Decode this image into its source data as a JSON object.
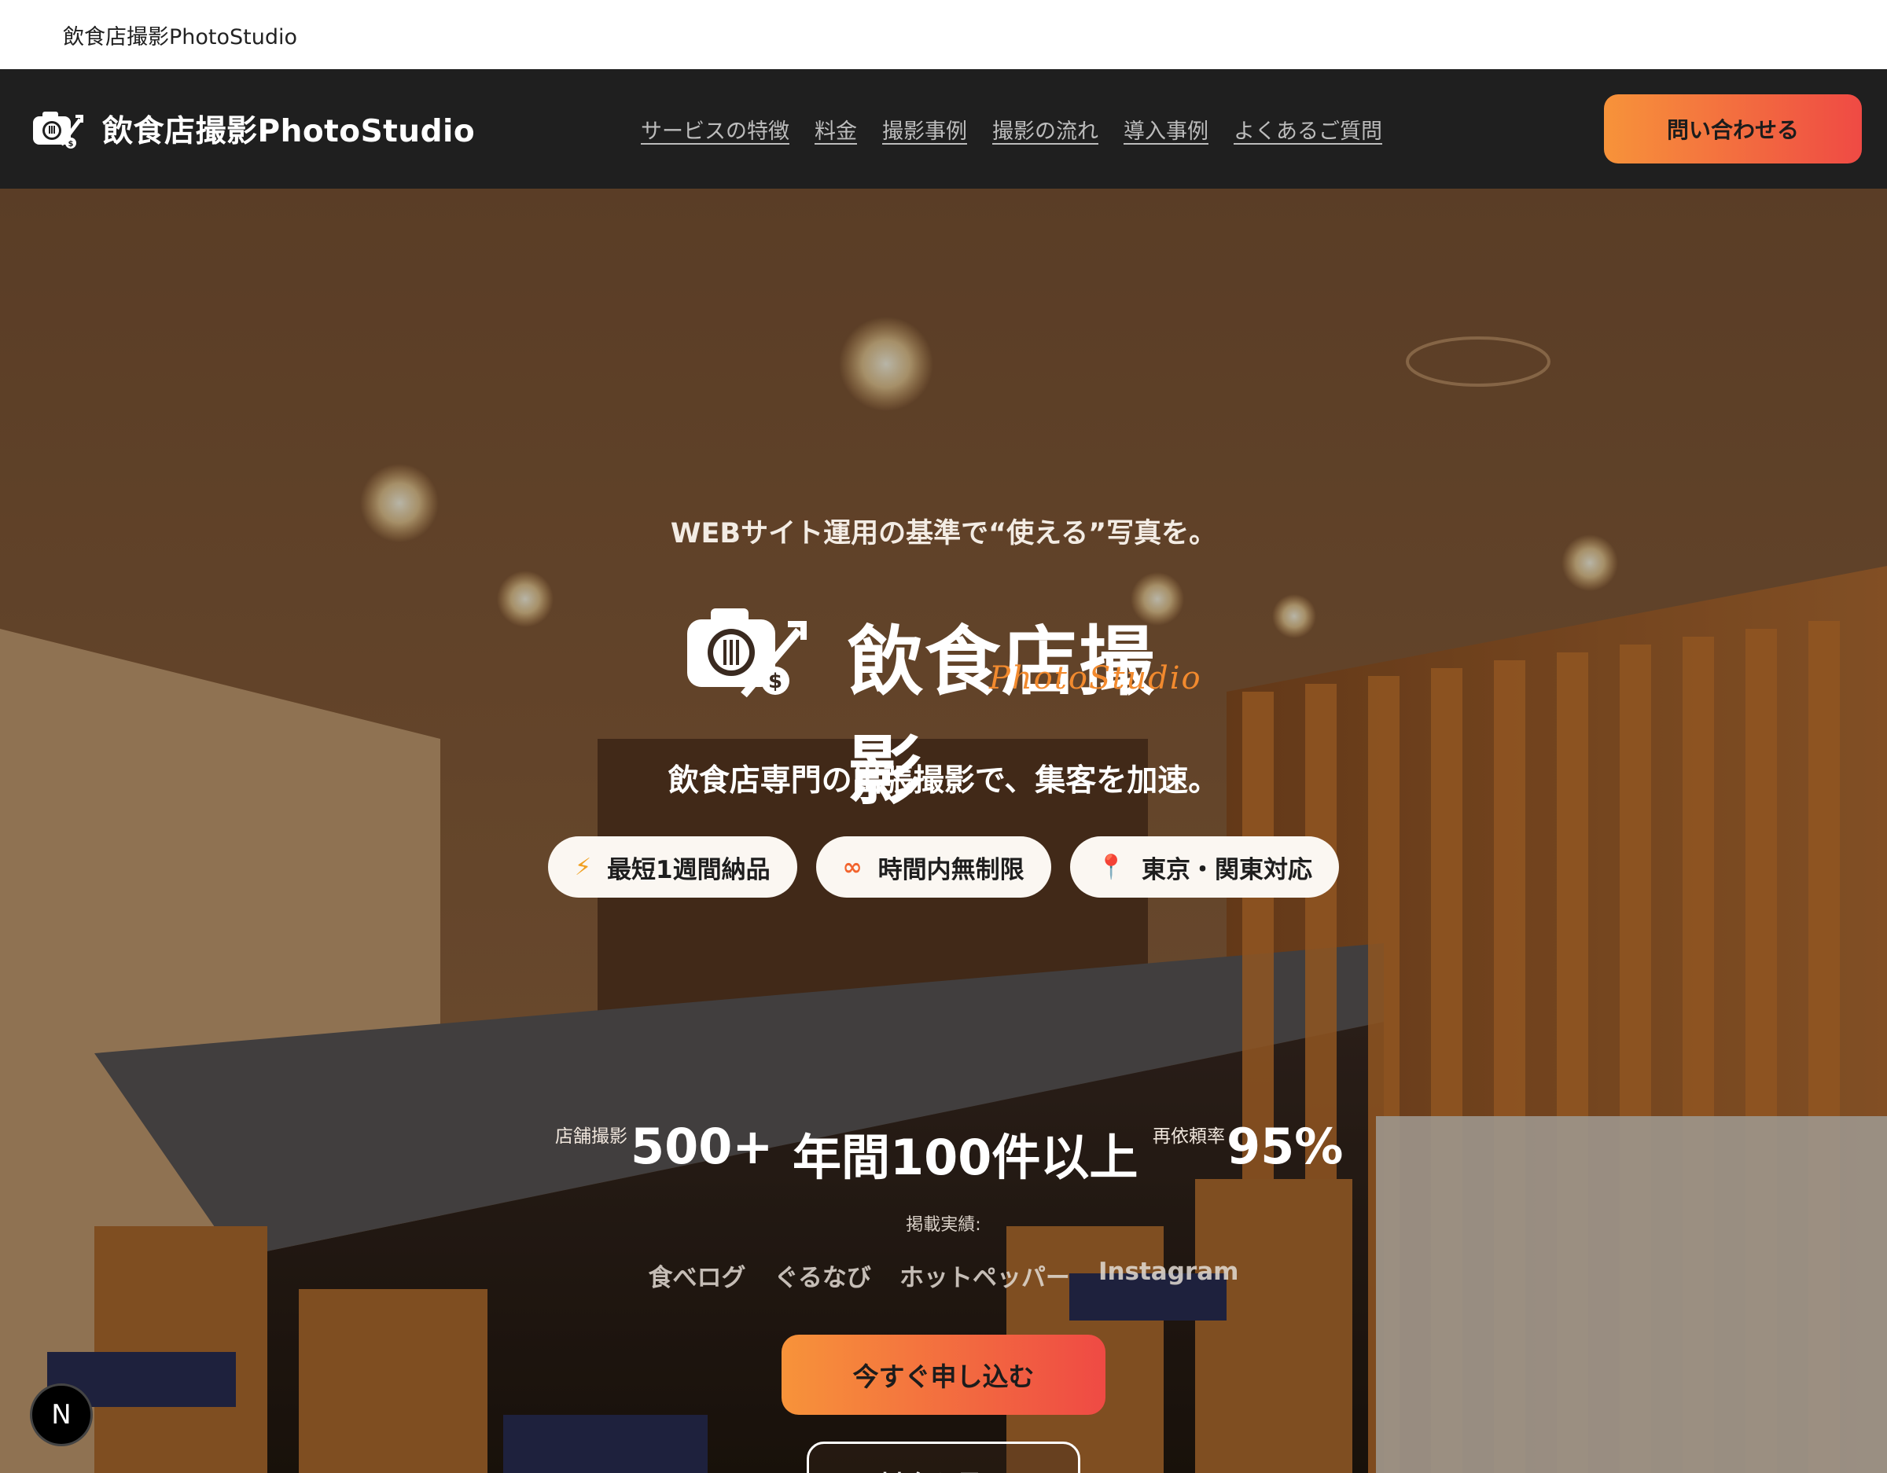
{
  "browser": {
    "tab_title": "飲食店撮影PhotoStudio"
  },
  "nav": {
    "brand_name": "飲食店撮影PhotoStudio",
    "brand_icon": "camera-fork-icon",
    "links": [
      "サービスの特徴",
      "料金",
      "撮影事例",
      "撮影の流れ",
      "導入事例",
      "よくあるご質問"
    ],
    "cta_label": "問い合わせる"
  },
  "hero": {
    "tagline": "WEBサイト運用の基準で“使える”写真を。",
    "logo_jp": "飲食店撮影",
    "logo_en": "PhotoStudio",
    "subtitle": "飲食店専門の出張撮影で、集客を加速。",
    "badges": [
      {
        "icon": "lightning-icon",
        "glyph": "⚡",
        "label": "最短1週間納品"
      },
      {
        "icon": "infinity-icon",
        "glyph": "∞",
        "label": "時間内無制限"
      },
      {
        "icon": "pin-icon",
        "glyph": "📍",
        "label": "東京・関東対応"
      }
    ],
    "stats": {
      "stores_label": "店舗撮影",
      "stores_value": "500+",
      "annual_value": "年間100件以上",
      "repeat_label": "再依頼率",
      "repeat_value": "95%"
    },
    "media_label": "掲載実績:",
    "media": [
      "食べログ",
      "ぐるなび",
      "ホットペッパー",
      "Instagram"
    ],
    "apply_label": "今すぐ申し込む",
    "price_label": "料金を見る"
  },
  "dev_badge": "N",
  "colors": {
    "accent_start": "#f7933a",
    "accent_end": "#ef4a44",
    "navbar_bg": "#1f1f1f",
    "logo_en": "#f28a2e"
  }
}
